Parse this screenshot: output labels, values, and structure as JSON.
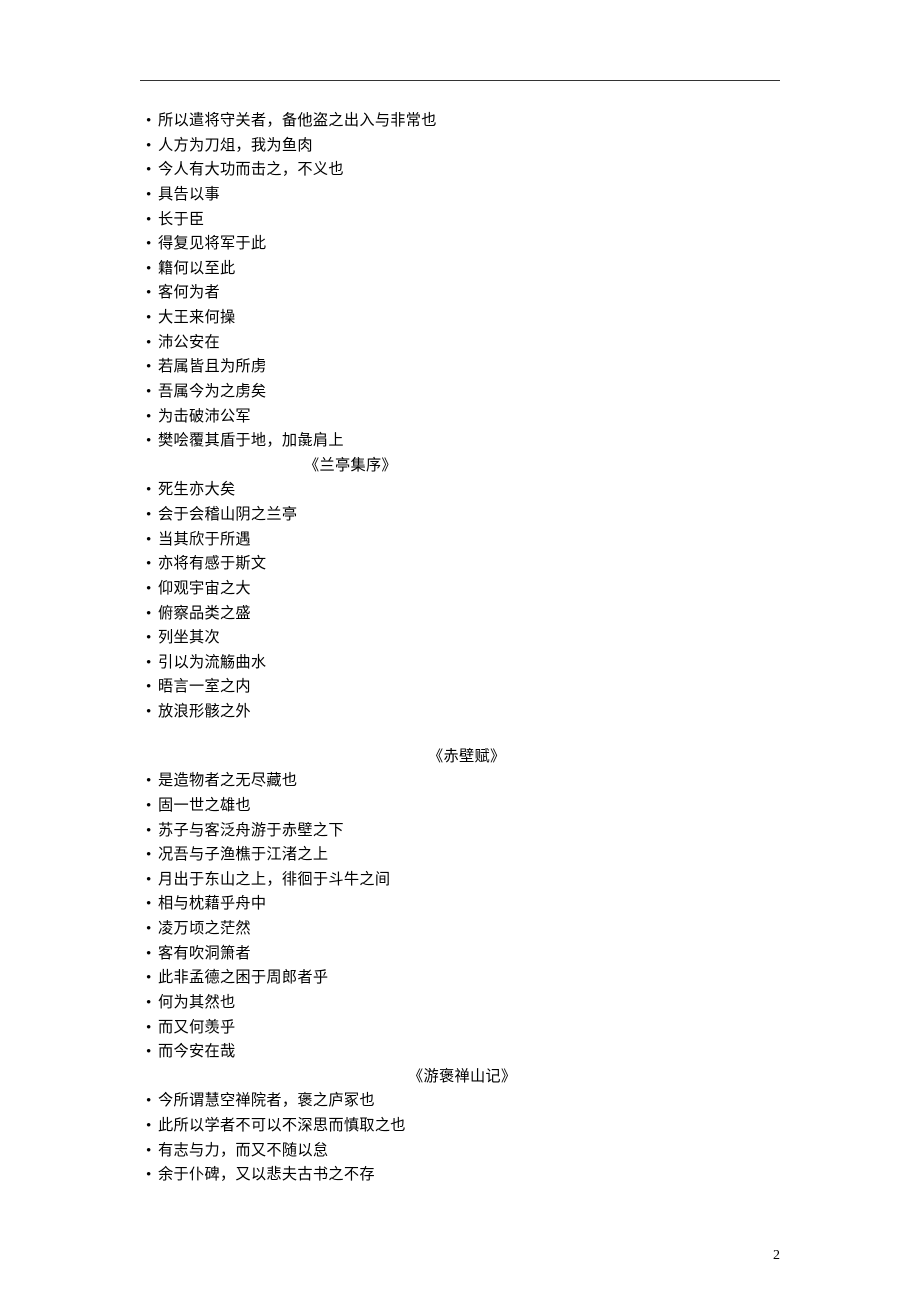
{
  "pageNumber": "2",
  "sections": [
    {
      "heading": null,
      "items": [
        "所以遣将守关者，备他盗之出入与非常也",
        "人方为刀俎，我为鱼肉",
        "今人有大功而击之，不义也",
        "具告以事",
        "长于臣",
        "得复见将军于此",
        "籍何以至此",
        "客何为者",
        "大王来何操",
        "沛公安在",
        "若属皆且为所虏",
        "吾属今为之虏矣",
        "为击破沛公军",
        "樊哙覆其盾于地，加彘肩上"
      ]
    },
    {
      "heading": "《兰亭集序》",
      "headingClass": "h1",
      "items": [
        "死生亦大矣",
        "会于会稽山阴之兰亭",
        "当其欣于所遇",
        "亦将有感于斯文",
        "仰观宇宙之大",
        "俯察品类之盛",
        "列坐其次",
        "引以为流觞曲水",
        "晤言一室之内",
        "放浪形骸之外"
      ]
    },
    {
      "heading": "《赤壁赋》",
      "headingClass": "h2",
      "items": [
        "是造物者之无尽藏也",
        "固一世之雄也",
        "苏子与客泛舟游于赤壁之下",
        "况吾与子渔樵于江渚之上",
        "月出于东山之上，徘徊于斗牛之间",
        "相与枕藉乎舟中",
        "凌万顷之茫然",
        "客有吹洞箫者",
        "此非孟德之困于周郎者乎",
        "何为其然也",
        "而又何羡乎",
        "而今安在哉"
      ]
    },
    {
      "heading": "《游褒禅山记》",
      "headingClass": "h3",
      "items": [
        "今所谓慧空禅院者，褒之庐冢也",
        "此所以学者不可以不深思而慎取之也",
        "有志与力，而又不随以怠",
        "余于仆碑，又以悲夫古书之不存"
      ]
    }
  ]
}
